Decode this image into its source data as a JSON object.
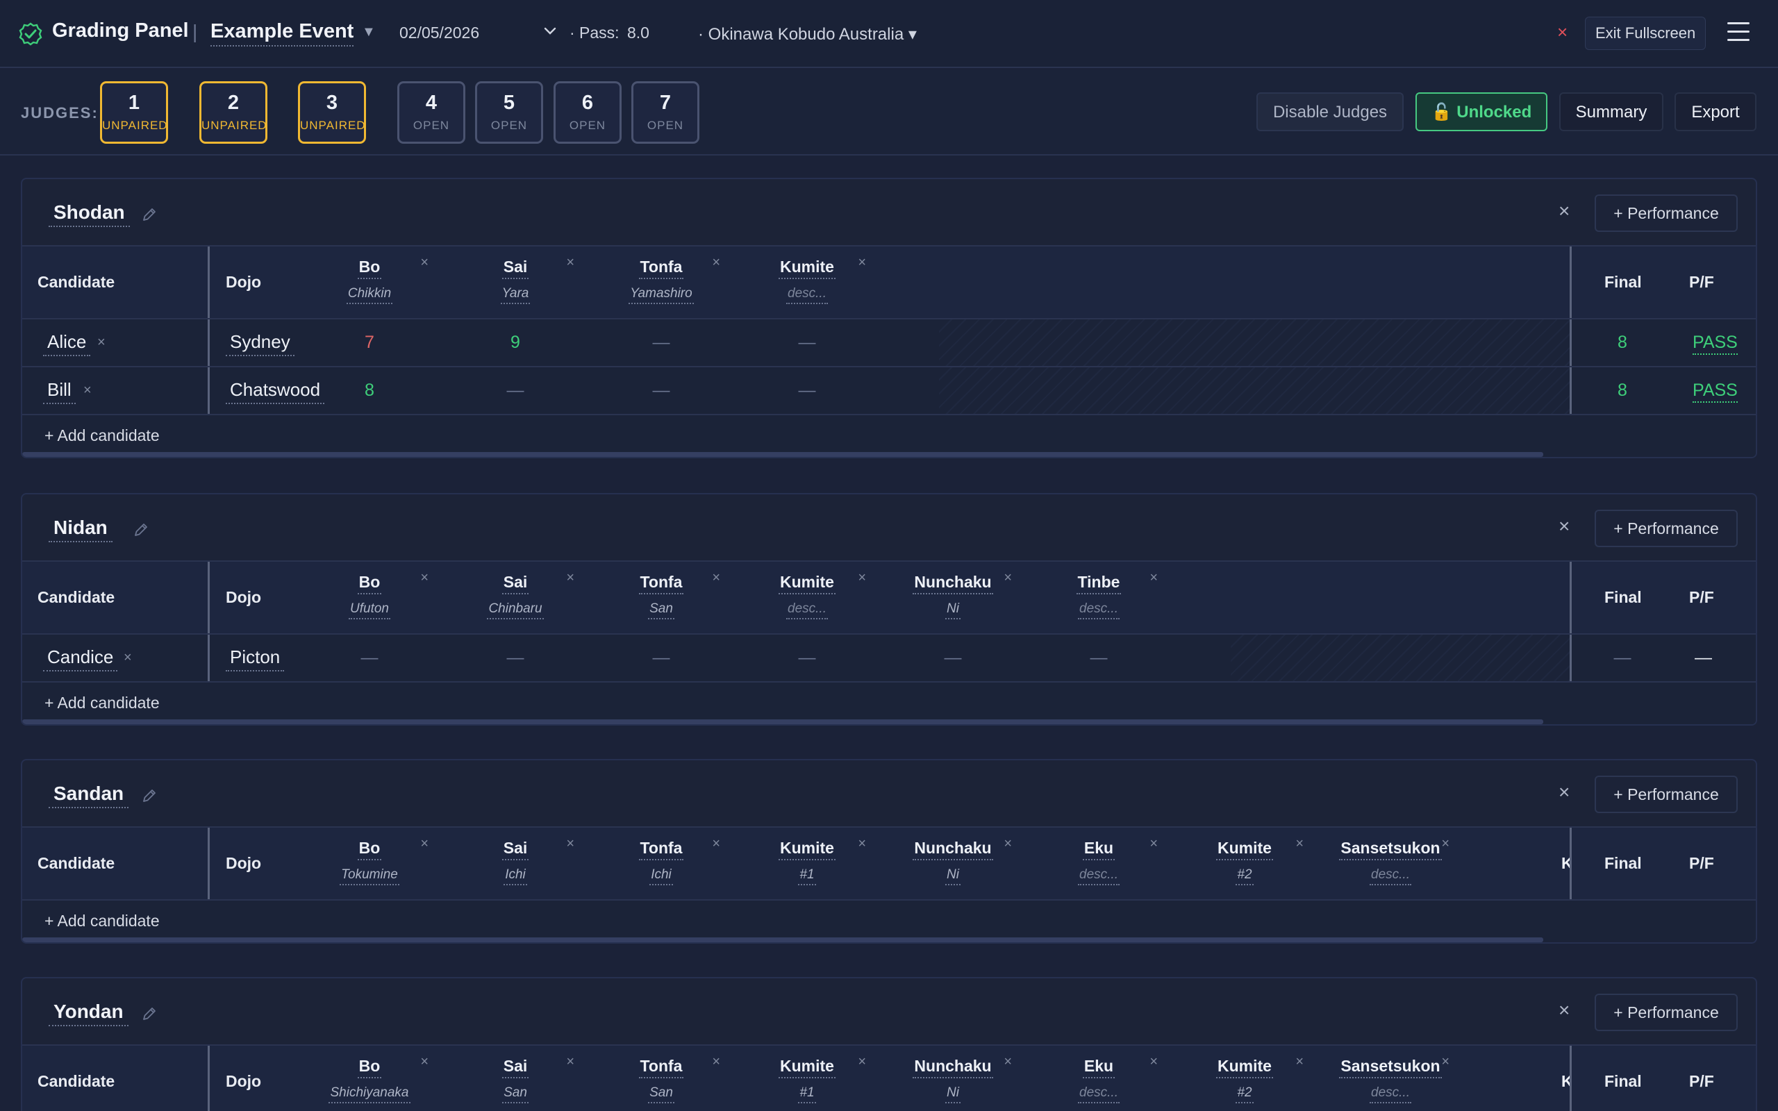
{
  "app": {
    "title": "Grading Panel",
    "separator": "|",
    "event_name": "Example Event",
    "event_caret": "▼",
    "date": "02/05/2026",
    "pass_label": "· Pass:",
    "pass_value": "8.0",
    "organization": "· Okinawa Kobudo Australia ▾",
    "exit_x": "×",
    "exit_label": "Exit Fullscreen"
  },
  "judges": {
    "label": "JUDGES:",
    "items": [
      {
        "num": "1",
        "status": "UNPAIRED"
      },
      {
        "num": "2",
        "status": "UNPAIRED"
      },
      {
        "num": "3",
        "status": "UNPAIRED"
      },
      {
        "num": "4",
        "status": "OPEN"
      },
      {
        "num": "5",
        "status": "OPEN"
      },
      {
        "num": "6",
        "status": "OPEN"
      },
      {
        "num": "7",
        "status": "OPEN"
      }
    ],
    "disable_label": "Disable Judges",
    "unlocked_label": "🔓 Unlocked",
    "summary_label": "Summary",
    "export_label": "Export"
  },
  "common": {
    "remove": "×",
    "add_performance": "+ Performance",
    "add_candidate": "+ Add candidate",
    "col_candidate": "Candidate",
    "col_dojo": "Dojo",
    "col_final": "Final",
    "col_pf": "P/F",
    "dash": "—"
  },
  "sections": [
    {
      "title": "Shodan",
      "performances": [
        {
          "name": "Bo",
          "desc": "Chikkin"
        },
        {
          "name": "Sai",
          "desc": "Yara"
        },
        {
          "name": "Tonfa",
          "desc": "Yamashiro"
        },
        {
          "name": "Kumite",
          "desc": "desc..."
        }
      ],
      "candidates": [
        {
          "name": "Alice",
          "dojo": "Sydney",
          "scores": [
            "7",
            "9",
            "—",
            "—"
          ],
          "final": "8",
          "pf": "PASS"
        },
        {
          "name": "Bill",
          "dojo": "Chatswood",
          "scores": [
            "8",
            "—",
            "—",
            "—"
          ],
          "final": "8",
          "pf": "PASS"
        }
      ]
    },
    {
      "title": "Nidan",
      "performances": [
        {
          "name": "Bo",
          "desc": "Ufuton"
        },
        {
          "name": "Sai",
          "desc": "Chinbaru"
        },
        {
          "name": "Tonfa",
          "desc": "San"
        },
        {
          "name": "Kumite",
          "desc": "desc..."
        },
        {
          "name": "Nunchaku",
          "desc": "Ni"
        },
        {
          "name": "Tinbe",
          "desc": "desc..."
        }
      ],
      "candidates": [
        {
          "name": "Candice",
          "dojo": "Picton",
          "scores": [
            "—",
            "—",
            "—",
            "—",
            "—",
            "—"
          ],
          "final": "—",
          "pf": "—"
        }
      ]
    },
    {
      "title": "Sandan",
      "performances": [
        {
          "name": "Bo",
          "desc": "Tokumine"
        },
        {
          "name": "Sai",
          "desc": "Ichi"
        },
        {
          "name": "Tonfa",
          "desc": "Ichi"
        },
        {
          "name": "Kumite",
          "desc": "#1"
        },
        {
          "name": "Nunchaku",
          "desc": "Ni"
        },
        {
          "name": "Eku",
          "desc": "desc..."
        },
        {
          "name": "Kumite",
          "desc": "#2"
        },
        {
          "name": "Sansetsukon",
          "desc": "desc..."
        }
      ],
      "cut_col": "K",
      "candidates": []
    },
    {
      "title": "Yondan",
      "performances": [
        {
          "name": "Bo",
          "desc": "Shichiyanaka"
        },
        {
          "name": "Sai",
          "desc": "San"
        },
        {
          "name": "Tonfa",
          "desc": "San"
        },
        {
          "name": "Kumite",
          "desc": "#1"
        },
        {
          "name": "Nunchaku",
          "desc": "Ni"
        },
        {
          "name": "Eku",
          "desc": "desc..."
        },
        {
          "name": "Kumite",
          "desc": "#2"
        },
        {
          "name": "Sansetsukon",
          "desc": "desc..."
        }
      ],
      "cut_col": "K",
      "candidates": []
    }
  ],
  "colors": {
    "background": "#1b2238",
    "unpaired": "#f0b832",
    "pass": "#3ecf7a",
    "low_score": "#e06666",
    "unlocked": "#4fd98a"
  }
}
